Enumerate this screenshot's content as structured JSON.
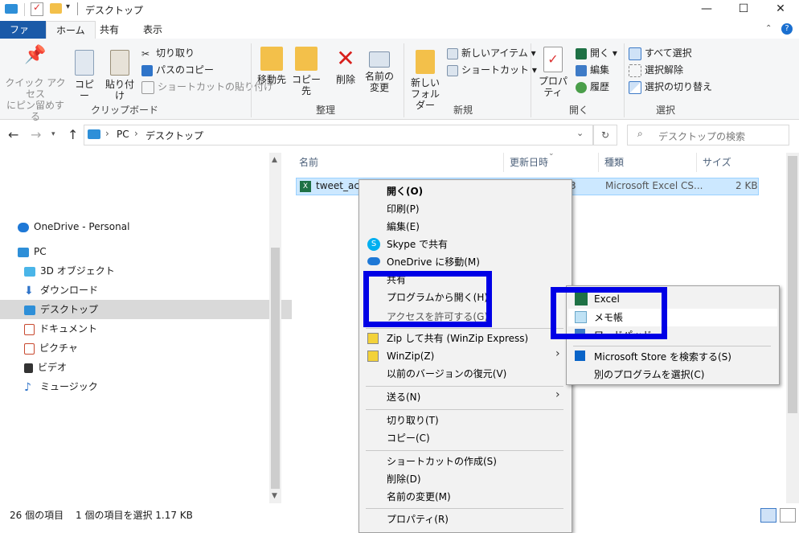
{
  "window": {
    "title": "デスクトップ"
  },
  "ribbon_tabs": [
    "ファイル",
    "ホーム",
    "共有",
    "表示"
  ],
  "clipboard": {
    "pin": "クイック アクセス\nにピン留めする",
    "copy": "コピー",
    "paste": "貼り付け",
    "cut": "切り取り",
    "copy_path": "パスのコピー",
    "paste_shortcut": "ショートカットの貼り付け",
    "label": "クリップボード"
  },
  "organize": {
    "move_to": "移動先",
    "copy_to": "コピー先",
    "delete": "削除",
    "rename": "名前の\n変更",
    "label": "整理"
  },
  "new_group": {
    "new_folder": "新しい\nフォルダー",
    "new_item": "新しいアイテム",
    "shortcut": "ショートカット",
    "label": "新規"
  },
  "open_group": {
    "properties": "プロパティ",
    "open": "開く",
    "edit": "編集",
    "history": "履歴",
    "label": "開く"
  },
  "select_group": {
    "select_all": "すべて選択",
    "select_none": "選択解除",
    "invert": "選択の切り替え",
    "label": "選択"
  },
  "address": {
    "crumbs": [
      "PC",
      "デスクトップ"
    ],
    "search_placeholder": "デスクトップの検索"
  },
  "nav_items": [
    {
      "label": "OneDrive - Personal",
      "icon": "cloud-icon",
      "color": "#1e78d6"
    },
    {
      "label": "PC",
      "icon": "pc-icon",
      "color": "#2e8fd8"
    },
    {
      "label": "3D オブジェクト",
      "icon": "cube-icon",
      "color": "#4ab5e8"
    },
    {
      "label": "ダウンロード",
      "icon": "download-icon",
      "color": "#2f74c9"
    },
    {
      "label": "デスクトップ",
      "icon": "desktop-icon",
      "color": "#2e8fd8"
    },
    {
      "label": "ドキュメント",
      "icon": "document-icon",
      "color": "#c8482e"
    },
    {
      "label": "ピクチャ",
      "icon": "picture-icon",
      "color": "#c8482e"
    },
    {
      "label": "ビデオ",
      "icon": "video-icon",
      "color": "#333333"
    },
    {
      "label": "ミュージック",
      "icon": "music-icon",
      "color": "#2f74c9"
    }
  ],
  "columns": [
    "名前",
    "更新日時",
    "種類",
    "サイズ"
  ],
  "file": {
    "name": "tweet_acti",
    "date_fragment": "3",
    "type": "Microsoft Excel CS...",
    "size": "2 KB"
  },
  "status": {
    "count": "26 個の項目",
    "selection": "1 個の項目を選択  1.17 KB"
  },
  "context_menu": {
    "open": "開く(O)",
    "print": "印刷(P)",
    "edit": "編集(E)",
    "skype": "Skype で共有",
    "onedrive": "OneDrive に移動(M)",
    "share": "共有",
    "open_with": "プログラムから開く(H)",
    "hidden_item": "アクセスを許可する(G)",
    "zip_share": "Zip して共有 (WinZip Express)",
    "winzip": "WinZip(Z)",
    "restore": "以前のバージョンの復元(V)",
    "send_to": "送る(N)",
    "cut": "切り取り(T)",
    "copy": "コピー(C)",
    "create_shortcut": "ショートカットの作成(S)",
    "delete": "削除(D)",
    "rename": "名前の変更(M)",
    "properties": "プロパティ(R)"
  },
  "submenu": {
    "excel": "Excel",
    "notepad": "メモ帳",
    "wordpad": "ワードパッド",
    "store": "Microsoft Store を検索する(S)",
    "other": "別のプログラムを選択(C)"
  },
  "highlight_color": "#0000e6",
  "accent": "#1a5aa8"
}
